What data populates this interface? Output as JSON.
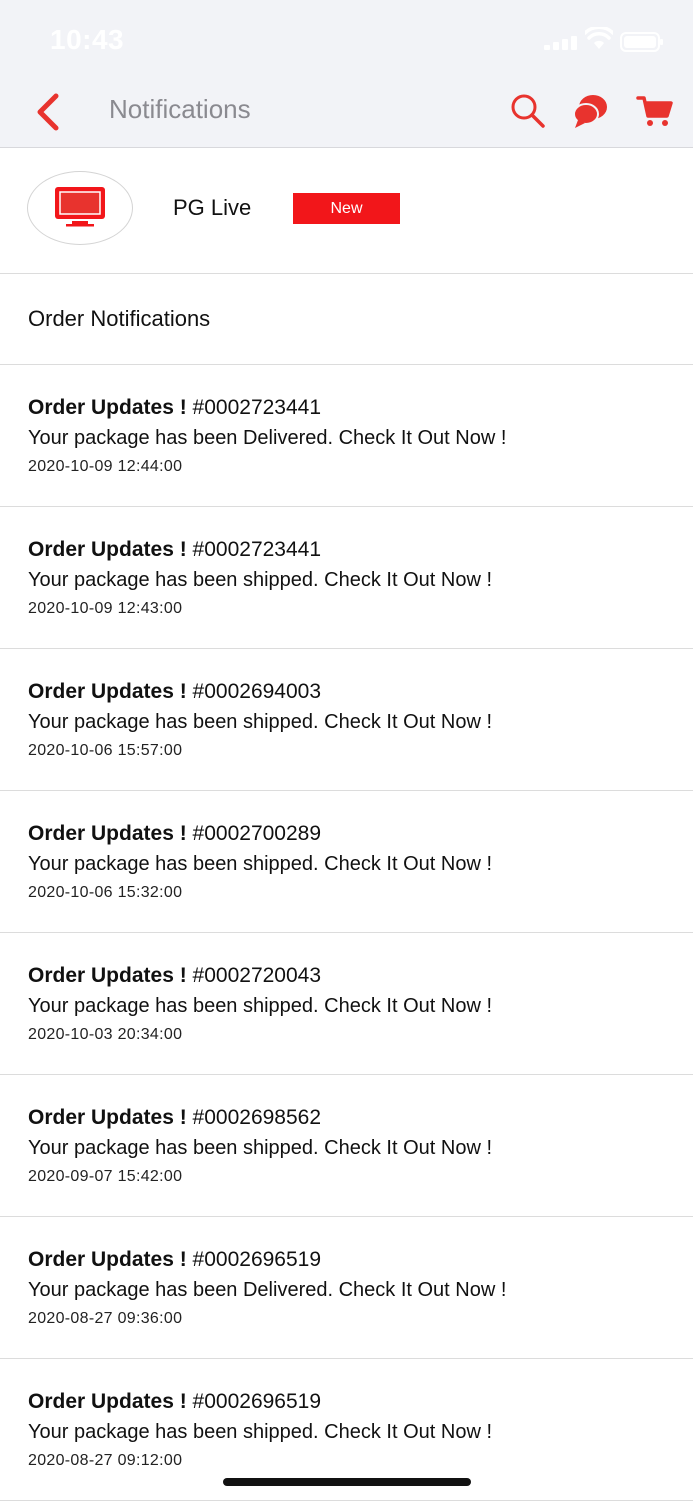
{
  "status_bar": {
    "time": "10:43"
  },
  "header": {
    "title": "Notifications",
    "accent": "#e8332e"
  },
  "live": {
    "name": "PG Live",
    "badge": "New",
    "badge_color": "#f2161a"
  },
  "section": {
    "label": "Order Notifications"
  },
  "notifications": [
    {
      "title": "Order Updates !",
      "order": "#0002723441",
      "message": "Your package has been Delivered. Check It Out Now !",
      "time": "2020-10-09 12:44:00"
    },
    {
      "title": "Order Updates !",
      "order": "#0002723441",
      "message": "Your package has been shipped. Check It Out Now !",
      "time": "2020-10-09 12:43:00"
    },
    {
      "title": "Order Updates !",
      "order": "#0002694003",
      "message": "Your package has been shipped. Check It Out Now !",
      "time": "2020-10-06 15:57:00"
    },
    {
      "title": "Order Updates !",
      "order": "#0002700289",
      "message": "Your package has been shipped. Check It Out Now !",
      "time": "2020-10-06 15:32:00"
    },
    {
      "title": "Order Updates !",
      "order": "#0002720043",
      "message": "Your package has been shipped. Check It Out Now !",
      "time": "2020-10-03 20:34:00"
    },
    {
      "title": "Order Updates !",
      "order": "#0002698562",
      "message": "Your package has been shipped. Check It Out Now !",
      "time": "2020-09-07 15:42:00"
    },
    {
      "title": "Order Updates !",
      "order": "#0002696519",
      "message": "Your package has been Delivered. Check It Out Now !",
      "time": "2020-08-27 09:36:00"
    },
    {
      "title": "Order Updates !",
      "order": "#0002696519",
      "message": "Your package has been shipped. Check It Out Now !",
      "time": "2020-08-27 09:12:00"
    }
  ]
}
